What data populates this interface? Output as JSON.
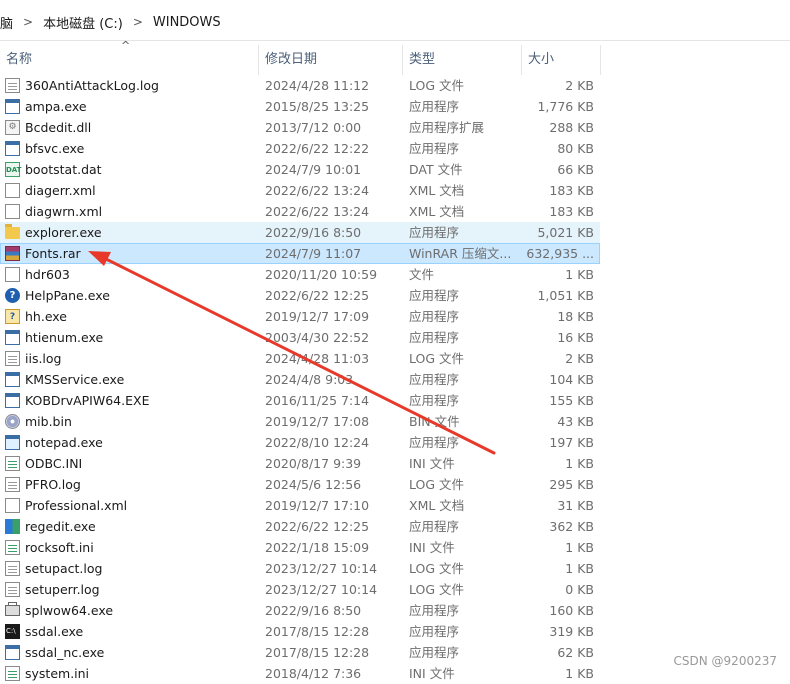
{
  "breadcrumb": {
    "items": [
      "脑",
      "本地磁盘 (C:)",
      "WINDOWS"
    ]
  },
  "header": {
    "sort_caret": "^",
    "name": "名称",
    "date": "修改日期",
    "type": "类型",
    "size": "大小"
  },
  "files": [
    {
      "name": "360AntiAttackLog.log",
      "date": "2024/4/28 11:12",
      "type": "LOG 文件",
      "size": "2 KB",
      "icon": "log-file-icon",
      "state": ""
    },
    {
      "name": "ampa.exe",
      "date": "2015/8/25 13:25",
      "type": "应用程序",
      "size": "1,776 KB",
      "icon": "exe-icon",
      "state": ""
    },
    {
      "name": "Bcdedit.dll",
      "date": "2013/7/12 0:00",
      "type": "应用程序扩展",
      "size": "288 KB",
      "icon": "dll-icon",
      "state": ""
    },
    {
      "name": "bfsvc.exe",
      "date": "2022/6/22 12:22",
      "type": "应用程序",
      "size": "80 KB",
      "icon": "exe-icon",
      "state": ""
    },
    {
      "name": "bootstat.dat",
      "date": "2024/7/9 10:01",
      "type": "DAT 文件",
      "size": "66 KB",
      "icon": "dat-file-icon",
      "state": ""
    },
    {
      "name": "diagerr.xml",
      "date": "2022/6/22 13:24",
      "type": "XML 文档",
      "size": "183 KB",
      "icon": "xml-file-icon",
      "state": ""
    },
    {
      "name": "diagwrn.xml",
      "date": "2022/6/22 13:24",
      "type": "XML 文档",
      "size": "183 KB",
      "icon": "xml-file-icon",
      "state": ""
    },
    {
      "name": "explorer.exe",
      "date": "2022/9/16 8:50",
      "type": "应用程序",
      "size": "5,021 KB",
      "icon": "folder-app-icon",
      "state": "hover"
    },
    {
      "name": "Fonts.rar",
      "date": "2024/7/9 11:07",
      "type": "WinRAR 压缩文...",
      "size": "632,935 ...",
      "icon": "winrar-archive-icon",
      "state": "selected"
    },
    {
      "name": "hdr603",
      "date": "2020/11/20 10:59",
      "type": "文件",
      "size": "1 KB",
      "icon": "blank-file-icon",
      "state": ""
    },
    {
      "name": "HelpPane.exe",
      "date": "2022/6/22 12:25",
      "type": "应用程序",
      "size": "1,051 KB",
      "icon": "help-icon",
      "state": ""
    },
    {
      "name": "hh.exe",
      "date": "2019/12/7 17:09",
      "type": "应用程序",
      "size": "18 KB",
      "icon": "help-book-icon",
      "state": ""
    },
    {
      "name": "htienum.exe",
      "date": "2003/4/30 22:52",
      "type": "应用程序",
      "size": "16 KB",
      "icon": "exe-icon",
      "state": ""
    },
    {
      "name": "iis.log",
      "date": "2024/4/28 11:03",
      "type": "LOG 文件",
      "size": "2 KB",
      "icon": "log-file-icon",
      "state": ""
    },
    {
      "name": "KMSService.exe",
      "date": "2024/4/8 9:03",
      "type": "应用程序",
      "size": "104 KB",
      "icon": "exe-icon",
      "state": ""
    },
    {
      "name": "KOBDrvAPIW64.EXE",
      "date": "2016/11/25 7:14",
      "type": "应用程序",
      "size": "155 KB",
      "icon": "exe-icon",
      "state": ""
    },
    {
      "name": "mib.bin",
      "date": "2019/12/7 17:08",
      "type": "BIN 文件",
      "size": "43 KB",
      "icon": "disc-icon",
      "state": ""
    },
    {
      "name": "notepad.exe",
      "date": "2022/8/10 12:24",
      "type": "应用程序",
      "size": "197 KB",
      "icon": "notepad-icon",
      "state": ""
    },
    {
      "name": "ODBC.INI",
      "date": "2020/8/17 9:39",
      "type": "INI 文件",
      "size": "1 KB",
      "icon": "ini-file-icon",
      "state": ""
    },
    {
      "name": "PFRO.log",
      "date": "2024/5/6 12:56",
      "type": "LOG 文件",
      "size": "295 KB",
      "icon": "log-file-icon",
      "state": ""
    },
    {
      "name": "Professional.xml",
      "date": "2019/12/7 17:10",
      "type": "XML 文档",
      "size": "31 KB",
      "icon": "xml-file-icon",
      "state": ""
    },
    {
      "name": "regedit.exe",
      "date": "2022/6/22 12:25",
      "type": "应用程序",
      "size": "362 KB",
      "icon": "regedit-icon",
      "state": ""
    },
    {
      "name": "rocksoft.ini",
      "date": "2022/1/18 15:09",
      "type": "INI 文件",
      "size": "1 KB",
      "icon": "ini-file-icon",
      "state": ""
    },
    {
      "name": "setupact.log",
      "date": "2023/12/27 10:14",
      "type": "LOG 文件",
      "size": "1 KB",
      "icon": "log-file-icon",
      "state": ""
    },
    {
      "name": "setuperr.log",
      "date": "2023/12/27 10:14",
      "type": "LOG 文件",
      "size": "0 KB",
      "icon": "log-file-icon",
      "state": ""
    },
    {
      "name": "splwow64.exe",
      "date": "2022/9/16 8:50",
      "type": "应用程序",
      "size": "160 KB",
      "icon": "printer-icon",
      "state": ""
    },
    {
      "name": "ssdal.exe",
      "date": "2017/8/15 12:28",
      "type": "应用程序",
      "size": "319 KB",
      "icon": "console-icon",
      "state": ""
    },
    {
      "name": "ssdal_nc.exe",
      "date": "2017/8/15 12:28",
      "type": "应用程序",
      "size": "62 KB",
      "icon": "exe-icon",
      "state": ""
    },
    {
      "name": "system.ini",
      "date": "2018/4/12 7:36",
      "type": "INI 文件",
      "size": "1 KB",
      "icon": "ini-file-icon",
      "state": ""
    }
  ],
  "annotation": {
    "color": "#e8382a"
  },
  "watermark": "CSDN @9200237"
}
